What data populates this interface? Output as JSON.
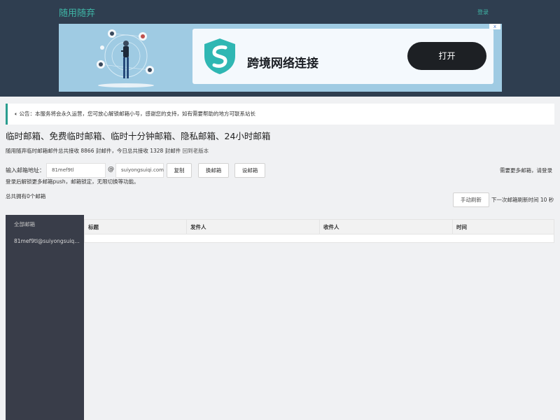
{
  "header": {
    "brand": "随用随弃",
    "login": "登录"
  },
  "ad": {
    "close": "x",
    "title": "跨境网络连接",
    "button": "打开"
  },
  "notice": {
    "icon": "speaker-icon",
    "prefix": "公告：",
    "text": "本服务将会永久运营，您可放心解锁邮箱小号，感谢您的支持，如有需要帮助的地方可联系站长"
  },
  "main": {
    "heading": "临时邮箱、免费临时邮箱、临时十分钟邮箱、隐私邮箱、24小时邮箱",
    "stats_text": "随用随弃临时邮箱邮件总共接收 8866 封邮件，今日总共接收 1328 封邮件",
    "old_version": "回到老版本",
    "input_label": "输入邮箱地址：",
    "email_value": "81mef9tl",
    "at": "@",
    "domain_value": "suiyongsuiqi.com",
    "copy_btn": "复制",
    "change_btn": "换邮箱",
    "set_btn": "设邮箱",
    "right_login": "需要更多邮箱，请登录",
    "tip": "登录后解锁更多邮箱push，邮箱锁定，无限切换等功能。",
    "total": "总共拥有0个邮箱",
    "refresh_btn": "手动刷新",
    "countdown": "下一次邮箱刷新时间 10 秒"
  },
  "sidebar": {
    "all": "全部邮箱",
    "items": [
      "81mef9tl@suiyongsuiqi.com"
    ]
  },
  "table": {
    "columns": [
      "标题",
      "发件人",
      "收件人",
      "时间"
    ]
  },
  "colors": {
    "topbar": "#2f3e50",
    "accent": "#3fb5a6",
    "sidebar": "#393d49"
  }
}
